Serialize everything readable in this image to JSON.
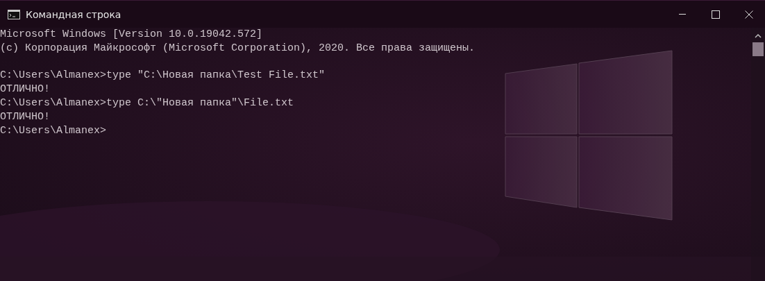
{
  "window": {
    "title": "Командная строка"
  },
  "console": {
    "blocks": [
      [
        "Microsoft Windows [Version 10.0.19042.572]",
        "(c) Корпорация Майкрософт (Microsoft Corporation), 2020. Все права защищены."
      ],
      [
        "C:\\Users\\Almanex>type \"C:\\Новая папка\\Test File.txt\"",
        "ОТЛИЧНО!",
        "C:\\Users\\Almanex>type C:\\\"Новая папка\"\\File.txt",
        "ОТЛИЧНО!",
        "C:\\Users\\Almanex>"
      ]
    ]
  }
}
